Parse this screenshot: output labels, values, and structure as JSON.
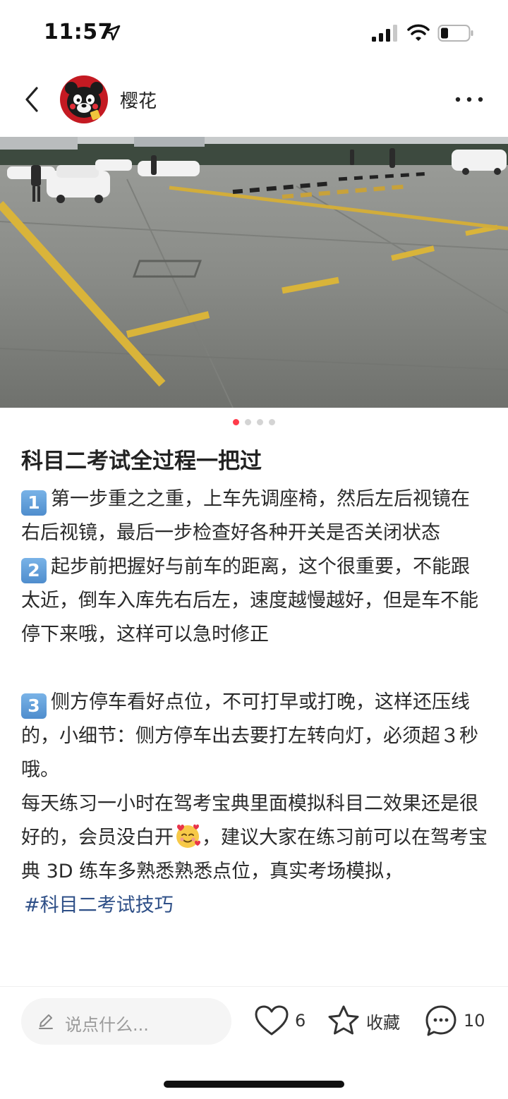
{
  "status_bar": {
    "time": "11:57",
    "icons": [
      "location-arrow-icon",
      "cellular-signal-icon",
      "wifi-icon",
      "battery-icon"
    ]
  },
  "header": {
    "username": "樱花",
    "back_icon": "chevron-left-icon",
    "more_icon": "more-dots-icon"
  },
  "carousel": {
    "total": 4,
    "active_index": 0
  },
  "post": {
    "title": "科目二考试全过程一把过",
    "items": [
      {
        "badge": "1",
        "text": "第一步重之之重，上车先调座椅，然后左后视镜在右后视镜，最后一步检查好各种开关是否关闭状态"
      },
      {
        "badge": "2",
        "text": "起步前把握好与前车的距离，这个很重要，不能跟太近，倒车入库先右后左，速度越慢越好，但是车不能停下来哦，这样可以急时修正"
      },
      {
        "badge": "3",
        "text": "侧方停车看好点位，不可打早或打晚，这样还压线的，小细节：侧方停车出去要打左转向灯，必须超３秒哦。"
      }
    ],
    "closing_before_emoji": "每天练习一小时在驾考宝典里面模拟科目二效果还是很好的，会员没白开",
    "closing_after_emoji": "，建议大家在练习前可以在驾考宝典 3D 练车多熟悉熟悉点位，真实考场模拟，",
    "hashtag": "#科目二考试技巧"
  },
  "bottom_bar": {
    "comment_placeholder": "说点什么...",
    "like_count": "6",
    "favorite_label": "收藏",
    "comment_count": "10"
  },
  "colors": {
    "accent": "#ff3b4a",
    "hashtag": "#2e4f87",
    "badge": "#5e9bd8"
  }
}
